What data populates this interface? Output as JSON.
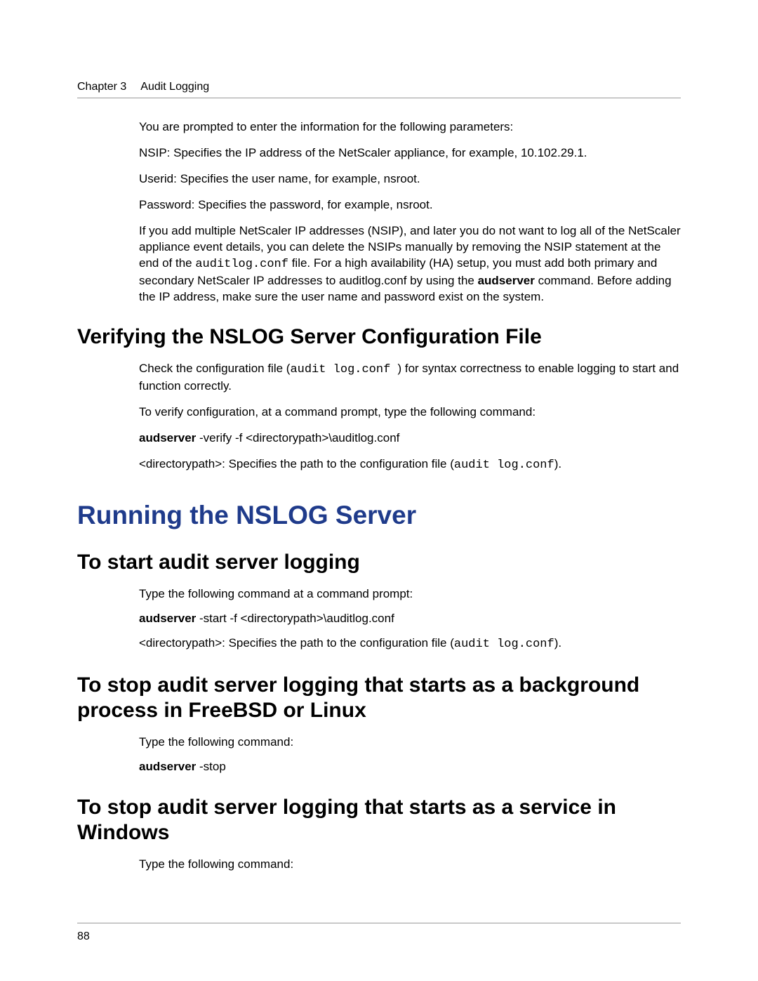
{
  "header": {
    "chapter": "Chapter 3",
    "title": "Audit Logging"
  },
  "intro": {
    "p1": "You are prompted to enter the information for the following parameters:",
    "p2": "NSIP: Specifies the IP address of the NetScaler appliance, for example, 10.102.29.1.",
    "p3": "Userid: Specifies the user name, for example, nsroot.",
    "p4": "Password: Specifies the password, for example, nsroot.",
    "p5_pre": "If you add multiple NetScaler IP addresses (NSIP), and later you do not want to log all of the NetScaler appliance event details, you can delete the NSIPs manually by removing the NSIP statement at the end of the ",
    "p5_code": "auditlog.conf",
    "p5_mid": " file. For a high availability (HA) setup, you must add both primary and secondary NetScaler IP addresses to auditlog.conf by using the ",
    "p5_bold": "audserver",
    "p5_post": " command. Before adding the IP address, make sure the user name and password exist on the system."
  },
  "section1": {
    "heading": "Verifying the NSLOG Server Configuration File",
    "p1_pre": "Check the configuration file (",
    "p1_code": "audit log.conf ",
    "p1_post": ") for syntax correctness to enable logging to start and function correctly.",
    "p2": "To verify configuration, at a command prompt, type the following command:",
    "p3_bold": "audserver",
    "p3_rest": " -verify -f <directorypath>\\auditlog.conf",
    "p4_pre": "<directorypath>: Specifies the path to the configuration file (",
    "p4_code": "audit log.conf",
    "p4_post": ")."
  },
  "section2": {
    "heading": "Running the NSLOG Server"
  },
  "section3": {
    "heading": "To start audit server logging",
    "p1": "Type the following command at a command prompt:",
    "p2_bold": "audserver",
    "p2_rest": " -start -f <directorypath>\\auditlog.conf",
    "p3_pre": "<directorypath>: Specifies the path to the configuration file (",
    "p3_code": "audit log.conf",
    "p3_post": ")."
  },
  "section4": {
    "heading": "To stop audit server logging that starts as a background process in FreeBSD or Linux",
    "p1": "Type the following command:",
    "p2_bold": "audserver",
    "p2_rest": " -stop"
  },
  "section5": {
    "heading": "To stop audit server logging that starts as a service in Windows",
    "p1": "Type the following command:"
  },
  "footer": {
    "page": "88"
  }
}
